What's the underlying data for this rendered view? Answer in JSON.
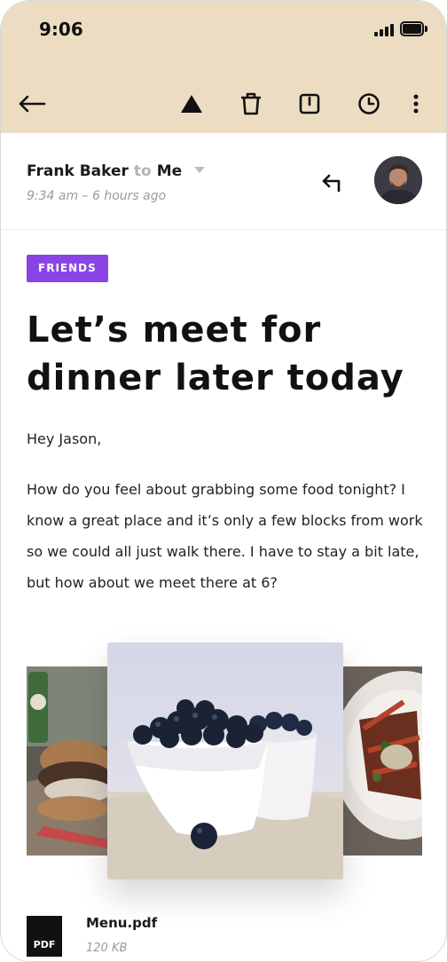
{
  "status_bar": {
    "time": "9:06"
  },
  "toolbar": {
    "back_icon": "arrow-left-icon",
    "actions": [
      "warning-icon",
      "trash-icon",
      "archive-icon",
      "clock-icon",
      "more-vertical-icon"
    ]
  },
  "email": {
    "from": "Frank Baker",
    "to_word": "to",
    "to": "Me",
    "time": "9:34 am – 6 hours ago",
    "tag": "FRIENDS",
    "subject": "Let’s meet for dinner later today",
    "greeting": "Hey Jason,",
    "body": "How do you feel about grabbing some food tonight? I know a great place and it’s only a few blocks from work so we could all just walk there. I have to stay a bit late, but how about we meet there at 6?"
  },
  "attachment": {
    "icon_label": "PDF",
    "name": "Menu.pdf",
    "size": "120 KB"
  },
  "colors": {
    "header_bg": "#ecdcc2",
    "tag_bg": "#8a44e6",
    "muted_text": "#9b9b9b"
  }
}
